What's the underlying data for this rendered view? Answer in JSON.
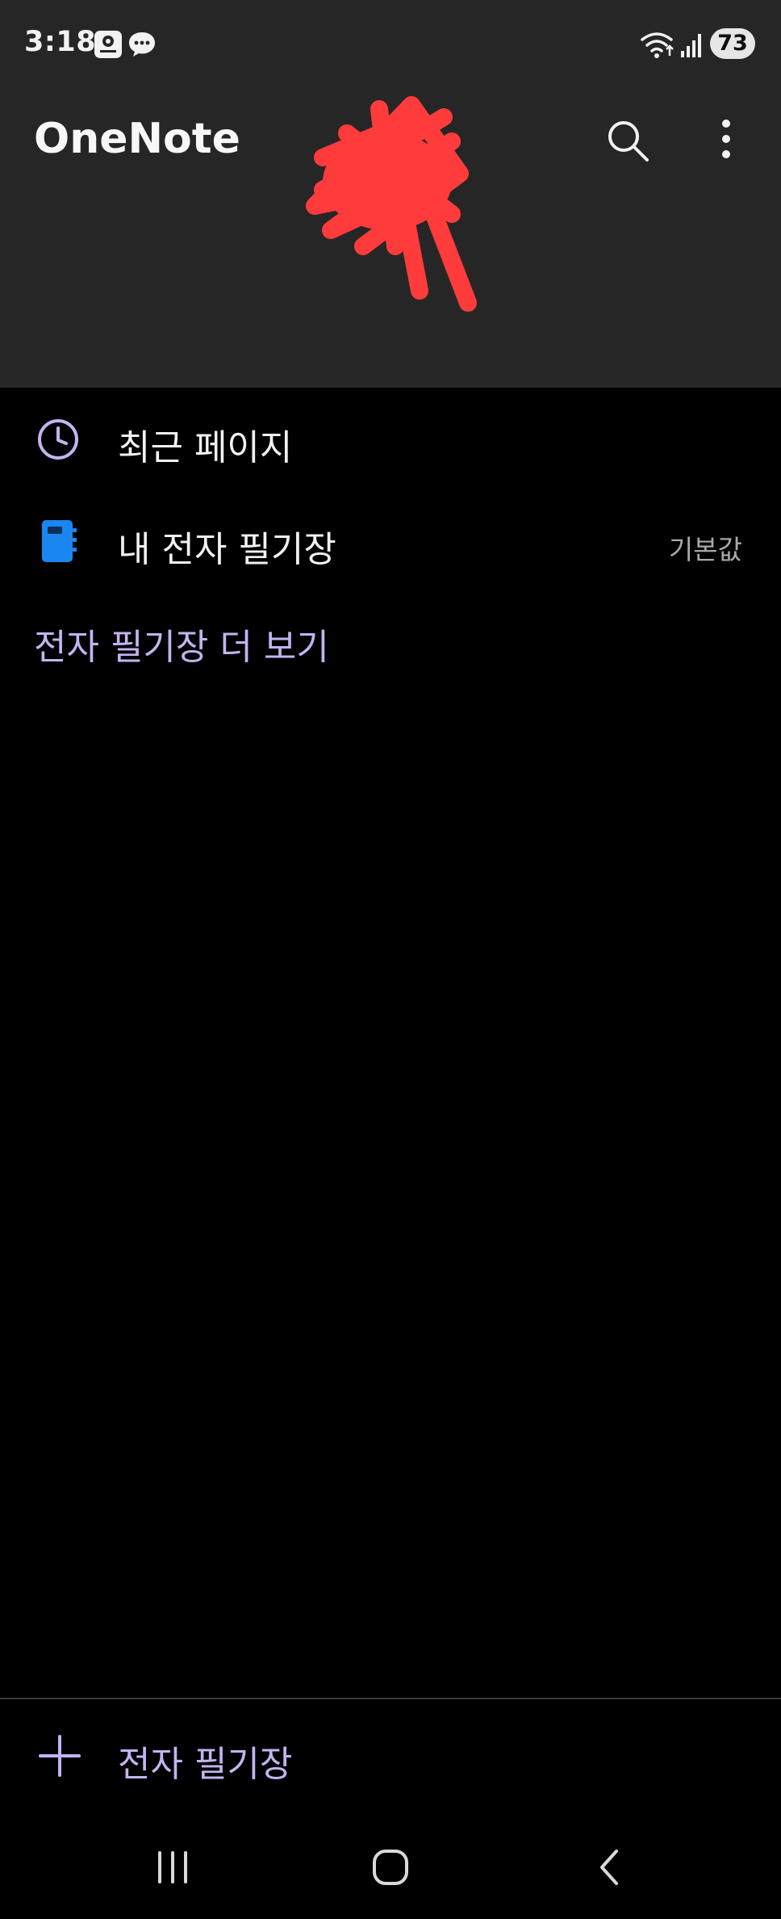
{
  "status_bar": {
    "time": "3:18",
    "battery_level": "73",
    "notification_icons": [
      "app-notification-icon",
      "chat-bubble-icon"
    ],
    "status_icons": [
      "wifi-icon",
      "signal-icon"
    ]
  },
  "header": {
    "app_title": "OneNote",
    "actions": [
      "search-icon",
      "more-vertical-icon"
    ]
  },
  "menu": {
    "items": [
      {
        "label": "최근 페이지",
        "icon": "clock-icon"
      },
      {
        "label": "내 전자 필기장",
        "icon": "notebook-icon",
        "badge": "기본값"
      }
    ],
    "more_link": "전자 필기장 더 보기"
  },
  "footer": {
    "add_label": "전자 필기장"
  },
  "navigation": [
    "recent-apps-icon",
    "home-icon",
    "back-icon"
  ],
  "colors": {
    "header_bg": "#262626",
    "body_bg": "#000000",
    "accent_purple": "#c5b3f0",
    "notebook_blue": "#1a86f0",
    "redaction_red": "#ff3b3b"
  }
}
